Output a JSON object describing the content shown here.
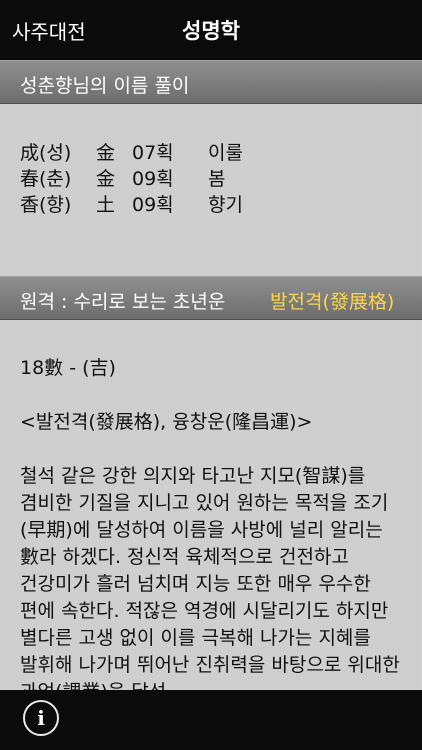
{
  "nav": {
    "back_label": "사주대전",
    "title": "성명학"
  },
  "name_section": {
    "header": "성춘향님의 이름 풀이",
    "rows": [
      {
        "hanja": "成(성)",
        "element": "金",
        "strokes": "07획",
        "meaning": "이룰"
      },
      {
        "hanja": "春(춘)",
        "element": "金",
        "strokes": "09획",
        "meaning": "봄"
      },
      {
        "hanja": "香(향)",
        "element": "土",
        "strokes": "09획",
        "meaning": "향기"
      }
    ]
  },
  "fortune_section": {
    "header": "원격 : 수리로 보는 초년운",
    "header_accent": "발전격(發展格)",
    "grade": "18數 - (吉)",
    "subtitle": "<발전격(發展格), 융창운(隆昌運)>",
    "description": "철석 같은 강한 의지와 타고난 지모(智謀)를 겸비한 기질을 지니고 있어 원하는 목적을 조기(早期)에 달성하여 이름을 사방에 널리 알리는 數라 하겠다. 정신적 육체적으로 건전하고 건강미가 흘러 넘치며 지능 또한 매우 우수한 편에 속한다. 적잖은 역경에 시달리기도 하지만 별다른 고생 없이 이를 극복해 나가는 지혜를 발휘해 나가며 뛰어난 진취력을 바탕으로 위대한 과업(課業)을 달성"
  },
  "toolbar": {
    "info_icon": "info-icon",
    "info_label": "i"
  }
}
